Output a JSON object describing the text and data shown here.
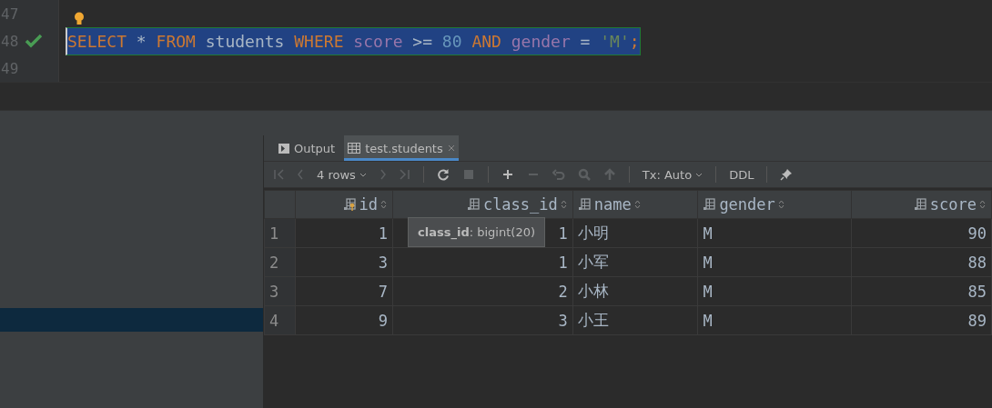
{
  "editor": {
    "lines": [
      {
        "number": "47",
        "bulb": true
      },
      {
        "number": "48",
        "ok": true,
        "selected": true,
        "tokens": [
          {
            "kind": "keyword",
            "text": "SELECT"
          },
          {
            "kind": "op",
            "text": " * "
          },
          {
            "kind": "keyword",
            "text": "FROM"
          },
          {
            "kind": "ident",
            "text": " students "
          },
          {
            "kind": "keyword",
            "text": "WHERE"
          },
          {
            "kind": "column",
            "text": " score"
          },
          {
            "kind": "op",
            "text": " >= "
          },
          {
            "kind": "number",
            "text": "80"
          },
          {
            "kind": "keyword",
            "text": " AND"
          },
          {
            "kind": "column",
            "text": " gender"
          },
          {
            "kind": "op",
            "text": " = "
          },
          {
            "kind": "string",
            "text": "'M'"
          },
          {
            "kind": "keyword",
            "text": ";"
          }
        ]
      },
      {
        "number": "49"
      }
    ]
  },
  "sidebar": {
    "rows": [
      {
        "selected": false
      },
      {
        "selected": false
      },
      {
        "selected": false
      },
      {
        "selected": false
      },
      {
        "selected": false
      },
      {
        "selected": false
      },
      {
        "selected": false
      },
      {
        "selected": true
      }
    ]
  },
  "tabs": [
    {
      "label": "Output",
      "kind": "console",
      "selected": false,
      "closable": false
    },
    {
      "label": "test.students",
      "kind": "table",
      "selected": true,
      "closable": true
    }
  ],
  "toolbar": {
    "rows": "4 rows",
    "tx": "Tx: Auto",
    "ddl": "DDL"
  },
  "table": {
    "columns": [
      {
        "name": "id",
        "key": true
      },
      {
        "name": "class_id",
        "key": false
      },
      {
        "name": "name",
        "key": false
      },
      {
        "name": "gender",
        "key": false
      },
      {
        "name": "score",
        "key": false
      }
    ],
    "rows": [
      {
        "number": "1",
        "cells": [
          {
            "text": "1"
          },
          {
            "text": "1",
            "tooltip": "**class_id**: bigint(20)"
          },
          {
            "text": "小明"
          },
          {
            "text": "M"
          },
          {
            "text": "90"
          }
        ]
      },
      {
        "number": "2",
        "cells": [
          {
            "text": "3"
          },
          {
            "text": "1"
          },
          {
            "text": "小军"
          },
          {
            "text": "M"
          },
          {
            "text": "88"
          }
        ]
      },
      {
        "number": "3",
        "cells": [
          {
            "text": "7"
          },
          {
            "text": "2"
          },
          {
            "text": "小林"
          },
          {
            "text": "M"
          },
          {
            "text": "85"
          }
        ]
      },
      {
        "number": "4",
        "cells": [
          {
            "text": "9"
          },
          {
            "text": "3"
          },
          {
            "text": "小王"
          },
          {
            "text": "M"
          },
          {
            "text": "89"
          }
        ]
      }
    ]
  }
}
